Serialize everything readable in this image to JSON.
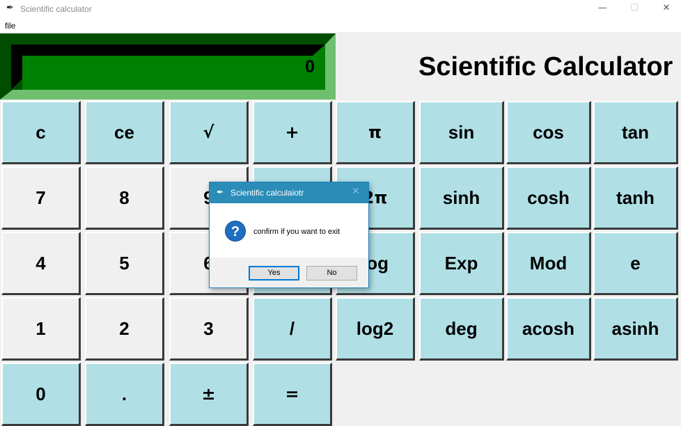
{
  "window": {
    "title": "Scientific calculator",
    "app_icon": "feather-icon",
    "controls": {
      "minimize": "—",
      "maximize": "☐",
      "close": "✕"
    }
  },
  "menu": {
    "file": "file"
  },
  "display": {
    "value": "0",
    "bg_color": "#008000",
    "frame_dark": "#004d00",
    "frame_light": "#6fbf6f"
  },
  "header": {
    "title": "Scientific Calculator"
  },
  "colors": {
    "button_blue": "#b0e0e6",
    "button_gray": "#f0f0f0",
    "dialog_title": "#2b8cb8"
  },
  "buttons": {
    "c": "c",
    "ce": "ce",
    "sqrt": "√",
    "add": "+",
    "pi": "π",
    "sin": "sin",
    "cos": "cos",
    "tan": "tan",
    "seven": "7",
    "eight": "8",
    "nine": "9",
    "two_pi": "2π",
    "sinh": "sinh",
    "cosh": "cosh",
    "tanh": "tanh",
    "four": "4",
    "five": "5",
    "six": "6",
    "log": "log",
    "exp": "Exp",
    "mod": "Mod",
    "e": "e",
    "one": "1",
    "two": "2",
    "three": "3",
    "divide": "/",
    "log2": "log2",
    "deg": "deg",
    "acosh": "acosh",
    "asinh": "asinh",
    "zero": "0",
    "dot": ".",
    "plus_minus": "±",
    "equals": "="
  },
  "dialog": {
    "title": "Scientific calculaiotr",
    "icon": "question-icon",
    "icon_glyph": "?",
    "message": "confirm if you want to exit",
    "yes_label": "Yes",
    "no_label": "No"
  }
}
